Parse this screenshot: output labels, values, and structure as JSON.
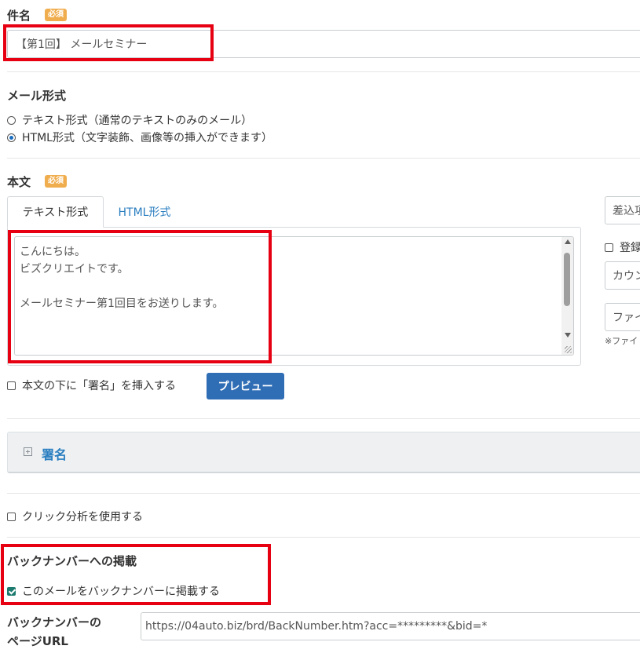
{
  "subject": {
    "label": "件名",
    "required_badge": "必須",
    "value": "【第1回】 メールセミナー"
  },
  "mail_format": {
    "label": "メール形式",
    "options": [
      {
        "label": "テキスト形式（通常のテキストのみのメール）",
        "selected": false
      },
      {
        "label": "HTML形式（文字装飾、画像等の挿入ができます）",
        "selected": true
      }
    ]
  },
  "body": {
    "label": "本文",
    "required_badge": "必須",
    "tabs": [
      {
        "label": "テキスト形式",
        "active": true
      },
      {
        "label": "HTML形式",
        "active": false
      }
    ],
    "text_lines": [
      "こんにちは。",
      "ビズクリエイトです。",
      "",
      "メールセミナー第1回目をお送りします。"
    ],
    "insert_signature_label": "本文の下に「署名」を挿入する",
    "insert_signature_checked": false,
    "preview_button": "プレビュー"
  },
  "side_panel": {
    "merge_field": "差込項",
    "register_label": "登録",
    "count_field": "カウン",
    "file_field": "ファイ",
    "file_note": "※ファイ"
  },
  "signature_section": {
    "expand_icon": "plus-square-icon",
    "title": "署名"
  },
  "click_analysis": {
    "label": "クリック分析を使用する",
    "checked": false
  },
  "backnumber": {
    "title": "バックナンバーへの掲載",
    "checkbox_label": "このメールをバックナンバーに掲載する",
    "checked": true,
    "url_label_line1": "バックナンバーの",
    "url_label_line2": "ページURL",
    "url_value": "https://04auto.biz/brd/BackNumber.htm?acc=*********&bid=*"
  },
  "colors": {
    "highlight": "#e60012",
    "link": "#2a7ec0",
    "primary_button": "#2f6db5",
    "badge": "#f0ad4e"
  }
}
